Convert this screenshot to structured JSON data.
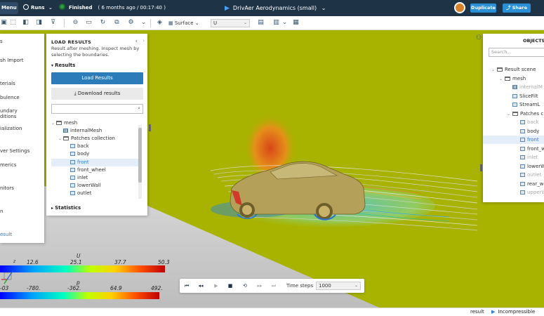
{
  "topbar": {
    "menu_label": "Menu",
    "runs_label": "Runs",
    "runs_caret": "⌄",
    "status_label": "Finished",
    "status_time": "( 6 months ago / 00:17:40 )",
    "project_title": "DrivAer Aerodynamics (small)",
    "title_caret": "⌄",
    "duplicate_label": "Duplicate",
    "share_label": "Share",
    "share_icon": "share-icon"
  },
  "toolbar": {
    "surface_label": "Surface",
    "field_select": "U"
  },
  "leftnav": {
    "items": [
      "s",
      "sh Import",
      "terials",
      "bulence",
      "undary",
      "ditions",
      "ialization",
      "ver Settings",
      "merics",
      "nitors",
      "n",
      "esult"
    ]
  },
  "load_panel": {
    "header": "LOAD RESULTS",
    "description": "Result after meshing. Inspect mesh by selecting the boundaries.",
    "results_section": "Results",
    "load_button": "Load Results",
    "download_button": "Download results",
    "statistics_section": "Statistics",
    "tree": [
      {
        "label": "mesh",
        "type": "folder",
        "indent": 0,
        "chev": "⌄"
      },
      {
        "label": "internalMesh",
        "type": "grid",
        "indent": 1
      },
      {
        "label": "Patches collection",
        "type": "folder",
        "indent": 1,
        "chev": "⌄"
      },
      {
        "label": "back",
        "type": "box",
        "indent": 2
      },
      {
        "label": "body",
        "type": "box",
        "indent": 2
      },
      {
        "label": "front",
        "type": "box",
        "indent": 2,
        "selected": true
      },
      {
        "label": "front_wheel",
        "type": "box",
        "indent": 2
      },
      {
        "label": "inlet",
        "type": "box",
        "indent": 2
      },
      {
        "label": "lowerWall",
        "type": "box",
        "indent": 2
      },
      {
        "label": "outlet",
        "type": "box",
        "indent": 2
      }
    ]
  },
  "objects_panel": {
    "header": "OBJECTS T",
    "search_placeholder": "Search...",
    "tree": [
      {
        "label": "Result scene",
        "type": "folder",
        "indent": 0,
        "chev": "⌄"
      },
      {
        "label": "mesh",
        "type": "folder",
        "indent": 1,
        "chev": "⌄"
      },
      {
        "label": "internalM",
        "type": "grid",
        "indent": 2,
        "dim": true
      },
      {
        "label": "SliceFilt",
        "type": "box",
        "indent": 2
      },
      {
        "label": "StreamL",
        "type": "box",
        "indent": 2
      },
      {
        "label": "Patches c",
        "type": "folder",
        "indent": 2,
        "chev": "⌄"
      },
      {
        "label": "back",
        "type": "box",
        "indent": 3,
        "dim": true
      },
      {
        "label": "body",
        "type": "box",
        "indent": 3
      },
      {
        "label": "front",
        "type": "box",
        "indent": 3,
        "selected": true
      },
      {
        "label": "front_wh",
        "type": "box",
        "indent": 3
      },
      {
        "label": "inlet",
        "type": "box",
        "indent": 3,
        "dim": true
      },
      {
        "label": "lowerW",
        "type": "box",
        "indent": 3
      },
      {
        "label": "outlet",
        "type": "box",
        "indent": 3,
        "dim": true
      },
      {
        "label": "rear_whe",
        "type": "box",
        "indent": 3
      },
      {
        "label": "upperW",
        "type": "box",
        "indent": 3,
        "dim": true
      }
    ]
  },
  "legend_u": {
    "title": "U",
    "ticks": [
      "12.6",
      "25.1",
      "37.7",
      "50.3"
    ],
    "axis_letter": "z"
  },
  "legend_p": {
    "title": "p",
    "ticks": [
      "-03",
      "-780.",
      "-362.",
      "64.9",
      "492."
    ]
  },
  "playback": {
    "time_steps_label": "Time steps",
    "time_steps_value": "1000"
  },
  "statusbar": {
    "result_label": "result",
    "solver_label": "Incompressible stea"
  },
  "colors": {
    "topbar_bg": "#1f3347",
    "accent": "#2b7cb8",
    "field_bg": "#a8b300",
    "finished_status": "#2ea043"
  }
}
